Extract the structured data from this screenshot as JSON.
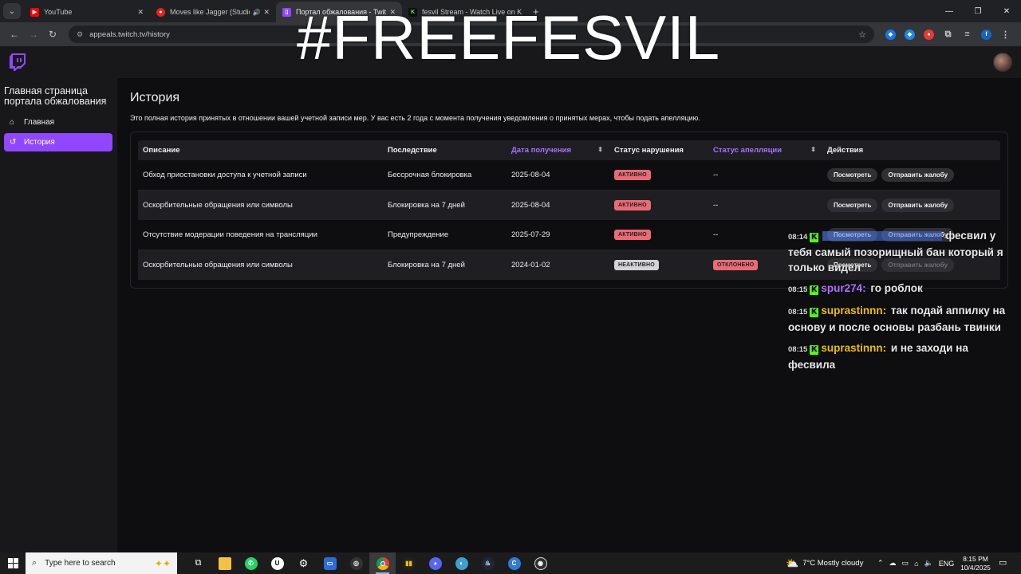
{
  "browser": {
    "tabs": [
      {
        "title": "YouTube",
        "favicon_color": "#ff0000",
        "active": false,
        "audio": false
      },
      {
        "title": "Moves like Jagger (Studio R",
        "favicon_color": "#e62117",
        "active": false,
        "audio": true
      },
      {
        "title": "Портал обжалования - Twitch",
        "favicon_color": "#9147ff",
        "active": true,
        "audio": false
      },
      {
        "title": "fesvil Stream - Watch Live on K",
        "favicon_color": "#53fc18",
        "active": false,
        "audio": false
      }
    ],
    "url": "appeals.twitch.tv/history"
  },
  "overlay": {
    "hashtag": "#FREEFESVIL"
  },
  "sidebar": {
    "title": "Главная страница портала обжалования",
    "items": [
      {
        "label": "Главная",
        "icon": "home-icon",
        "active": false
      },
      {
        "label": "История",
        "icon": "history-icon",
        "active": true
      }
    ]
  },
  "main": {
    "title": "История",
    "description": "Это полная история принятых в отношении вашей учетной записи мер. У вас есть 2 года с момента получения уведомления о принятых мерах, чтобы подать апелляцию.",
    "table": {
      "headers": [
        "Описание",
        "Последствие",
        "Дата получения",
        "Статус нарушения",
        "Статус апелляции",
        "Действия"
      ],
      "rows": [
        {
          "description": "Обход приостановки доступа к учетной записи",
          "consequence": "Бессрочная блокировка",
          "date": "2025-08-04",
          "violation_status": "АКТИВНО",
          "appeal_status": "--",
          "view": "Посмотреть",
          "appeal": "Отправить жалобу"
        },
        {
          "description": "Оскорбительные обращения или символы",
          "consequence": "Блокировка на 7 дней",
          "date": "2025-08-04",
          "violation_status": "АКТИВНО",
          "appeal_status": "--",
          "view": "Посмотреть",
          "appeal": "Отправить жалобу"
        },
        {
          "description": "Отсутствие модерации поведения на трансляции",
          "consequence": "Предупреждение",
          "date": "2025-07-29",
          "violation_status": "АКТИВНО",
          "appeal_status": "--",
          "view": "Посмотреть",
          "appeal": "Отправить жалобу"
        },
        {
          "description": "Оскорбительные обращения или символы",
          "consequence": "Блокировка на 7 дней",
          "date": "2024-01-02",
          "violation_status": "НЕАКТИВНО",
          "appeal_status": "ОТКЛОНЕНО",
          "view": "Посмотреть",
          "appeal": "Отправить жалобу"
        }
      ]
    }
  },
  "chat": [
    {
      "time": "08:14",
      "user": "",
      "text": "фесвил у тебя самый позорищный бан который я только видел",
      "user_color": "#5a8cff"
    },
    {
      "time": "08:15",
      "user": "spur274:",
      "text": "го роблок",
      "user_color": "#b070ff"
    },
    {
      "time": "08:15",
      "user": "suprastinnn:",
      "text": "так подай аппилку на основу и после основы разбань твинки",
      "user_color": "#f0c000"
    },
    {
      "time": "08:15",
      "user": "suprastinnn:",
      "text": "и не заходи на фесвила",
      "user_color": "#f0c000"
    }
  ],
  "taskbar": {
    "search_placeholder": "Type here to search",
    "weather": "7°C  Mostly cloudy",
    "language": "ENG",
    "time": "8:15 PM",
    "date": "10/4/2025"
  }
}
